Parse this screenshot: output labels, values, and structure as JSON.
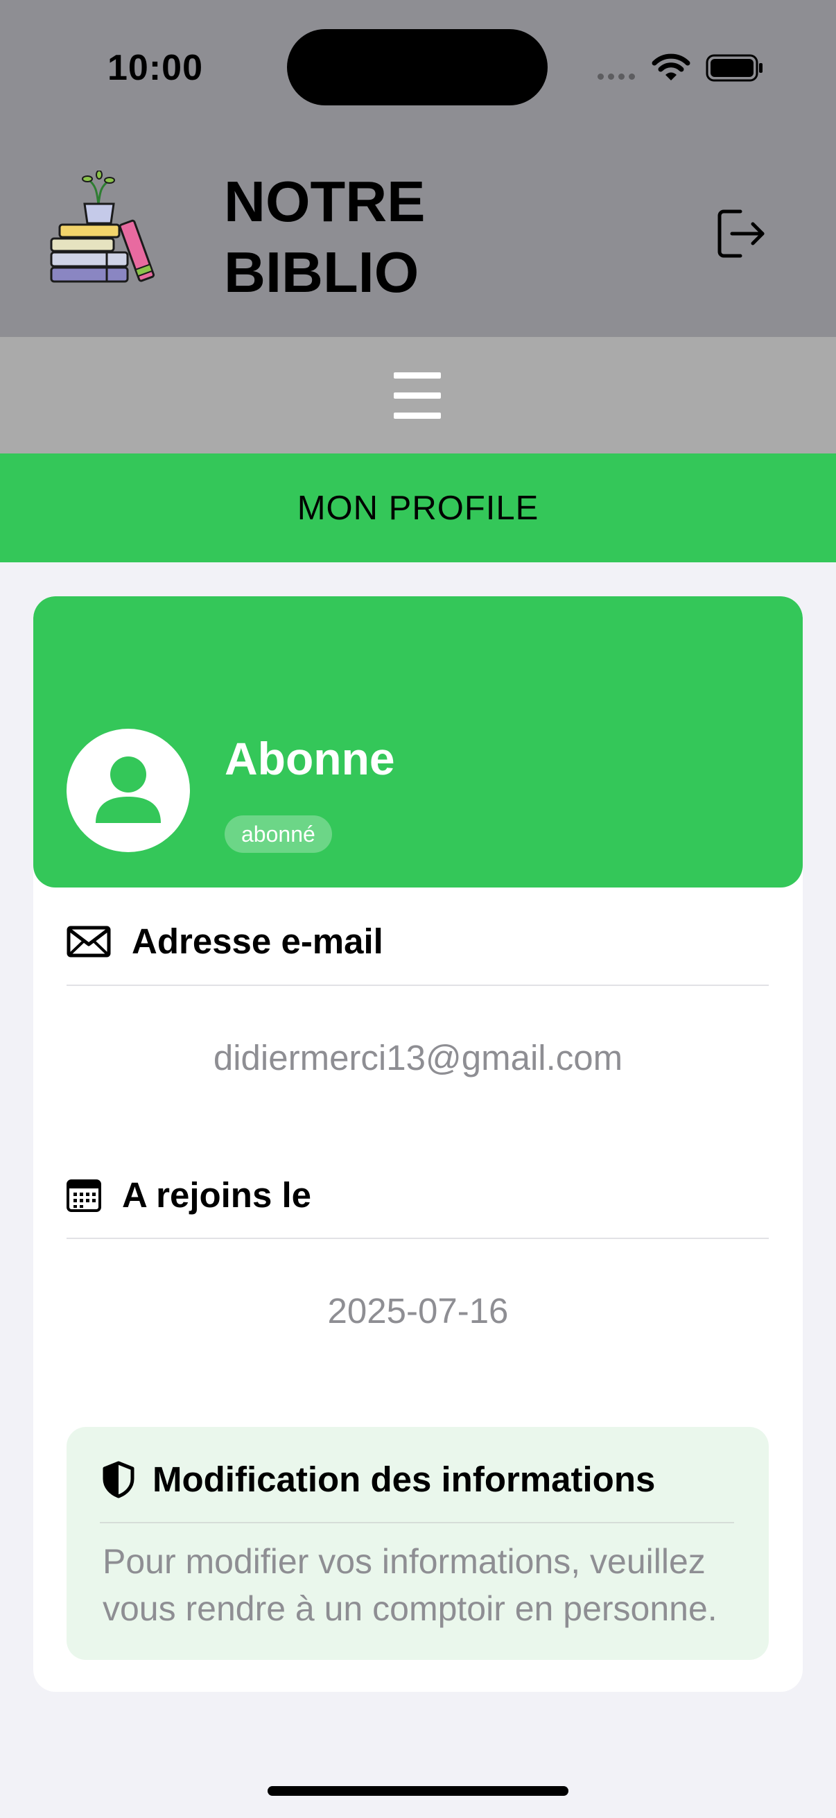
{
  "status_bar": {
    "time": "10:00"
  },
  "app": {
    "title_line1": "NOTRE",
    "title_line2": "BIBLIO"
  },
  "section": {
    "title": "MON PROFILE"
  },
  "profile": {
    "name": "Abonne",
    "role": "abonné",
    "email_label": "Adresse e-mail",
    "email": "didiermerci13@gmail.com",
    "joined_label": "A rejoins le",
    "joined_date": "2025-07-16"
  },
  "info_box": {
    "title": "Modification des informations",
    "text": "Pour modifier vos informations, veuillez vous rendre à un comptoir en personne."
  },
  "colors": {
    "header": "#8e8e93",
    "menu_bar": "#aaaaaa",
    "accent": "#34c759",
    "info_bg": "#eaf7ec"
  },
  "icons": {
    "logo": "books-plant-logo",
    "logout": "logout-icon",
    "menu": "hamburger-menu-icon",
    "email": "envelope-icon",
    "date": "calendar-icon",
    "info": "shield-icon"
  }
}
